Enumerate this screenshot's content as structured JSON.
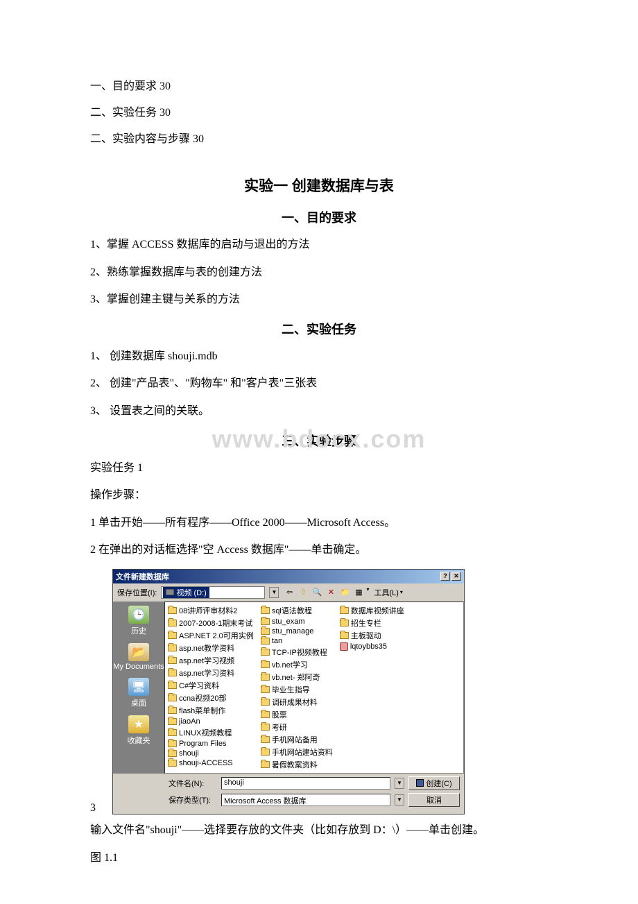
{
  "toc": [
    "一、目的要求 30",
    "二、实验任务 30",
    "二、实验内容与步骤 30"
  ],
  "title": "实验一 创建数据库与表",
  "sec1": {
    "heading": "一、目的要求",
    "items": [
      "1、掌握 ACCESS 数据库的启动与退出的方法",
      "2、熟练掌握数据库与表的创建方法",
      "3、掌握创建主键与关系的方法"
    ]
  },
  "sec2": {
    "heading": "二、实验任务",
    "items": [
      "1、 创建数据库 shouji.mdb",
      "2、 创建\"产品表\"、\"购物车\" 和\"客户表\"三张表",
      "3、 设置表之间的关联。"
    ]
  },
  "sec3": {
    "heading": "三、实验步骤",
    "task_label": "实验任务 1",
    "steps_label": "操作步骤：",
    "step1": "1 单击开始——所有程序——Office 2000——Microsoft Access。",
    "step2": "2 在弹出的对话框选择\"空 Access 数据库\"——单击确定。",
    "step3_num": "3",
    "step3_tail": "输入文件名\"shouji\"——选择要存放的文件夹（比如存放到 D：\\）——单击创建。",
    "fig": "图 1.1"
  },
  "watermark": "www.bdocx.com",
  "dialog": {
    "title": "文件新建数据库",
    "help_glyph": "?",
    "close_glyph": "✕",
    "loc_label": "保存位置(I):",
    "drive": "视频 (D:)",
    "tools_label": "工具(L)",
    "nav_back": "⇦",
    "nav_up": "⇧",
    "icon_search": "🔍",
    "icon_delete": "✕",
    "icon_newfolder": "📁",
    "icon_views": "▦",
    "places": {
      "history": "历史",
      "my_docs": "My Documents",
      "desktop": "桌面",
      "favorites": "收藏夹"
    },
    "cols": [
      [
        "08讲师评审材料2",
        "2007-2008-1期末考试",
        "ASP.NET 2.0可用实例",
        "asp.net教学资料",
        "asp.net学习视频",
        "asp.net学习资料",
        "C#学习资料",
        "ccna视频20部",
        "flash菜单制作",
        "jiaoAn",
        "LINUX视频教程",
        "Program Files",
        "shouji",
        "shouji-ACCESS"
      ],
      [
        "sql语法教程",
        "stu_exam",
        "stu_manage",
        "tan",
        "TCP-IP视频教程",
        "vb.net学习",
        "vb.net- 郑阿奇",
        "毕业生指导",
        "调研成果材料",
        "股票",
        "考研",
        "手机网站备用",
        "手机网站建站资料",
        "暑假教案资料"
      ],
      [
        "数据库视频讲座",
        "招生专栏",
        "主板驱动",
        "lqtoybbs35"
      ]
    ],
    "col3_file_index": 3,
    "fn_label": "文件名(N):",
    "fn_value": "shouji",
    "ft_label": "保存类型(T):",
    "ft_value": "Microsoft Access 数据库",
    "btn_create": "创建(C)",
    "btn_cancel": "取消"
  }
}
